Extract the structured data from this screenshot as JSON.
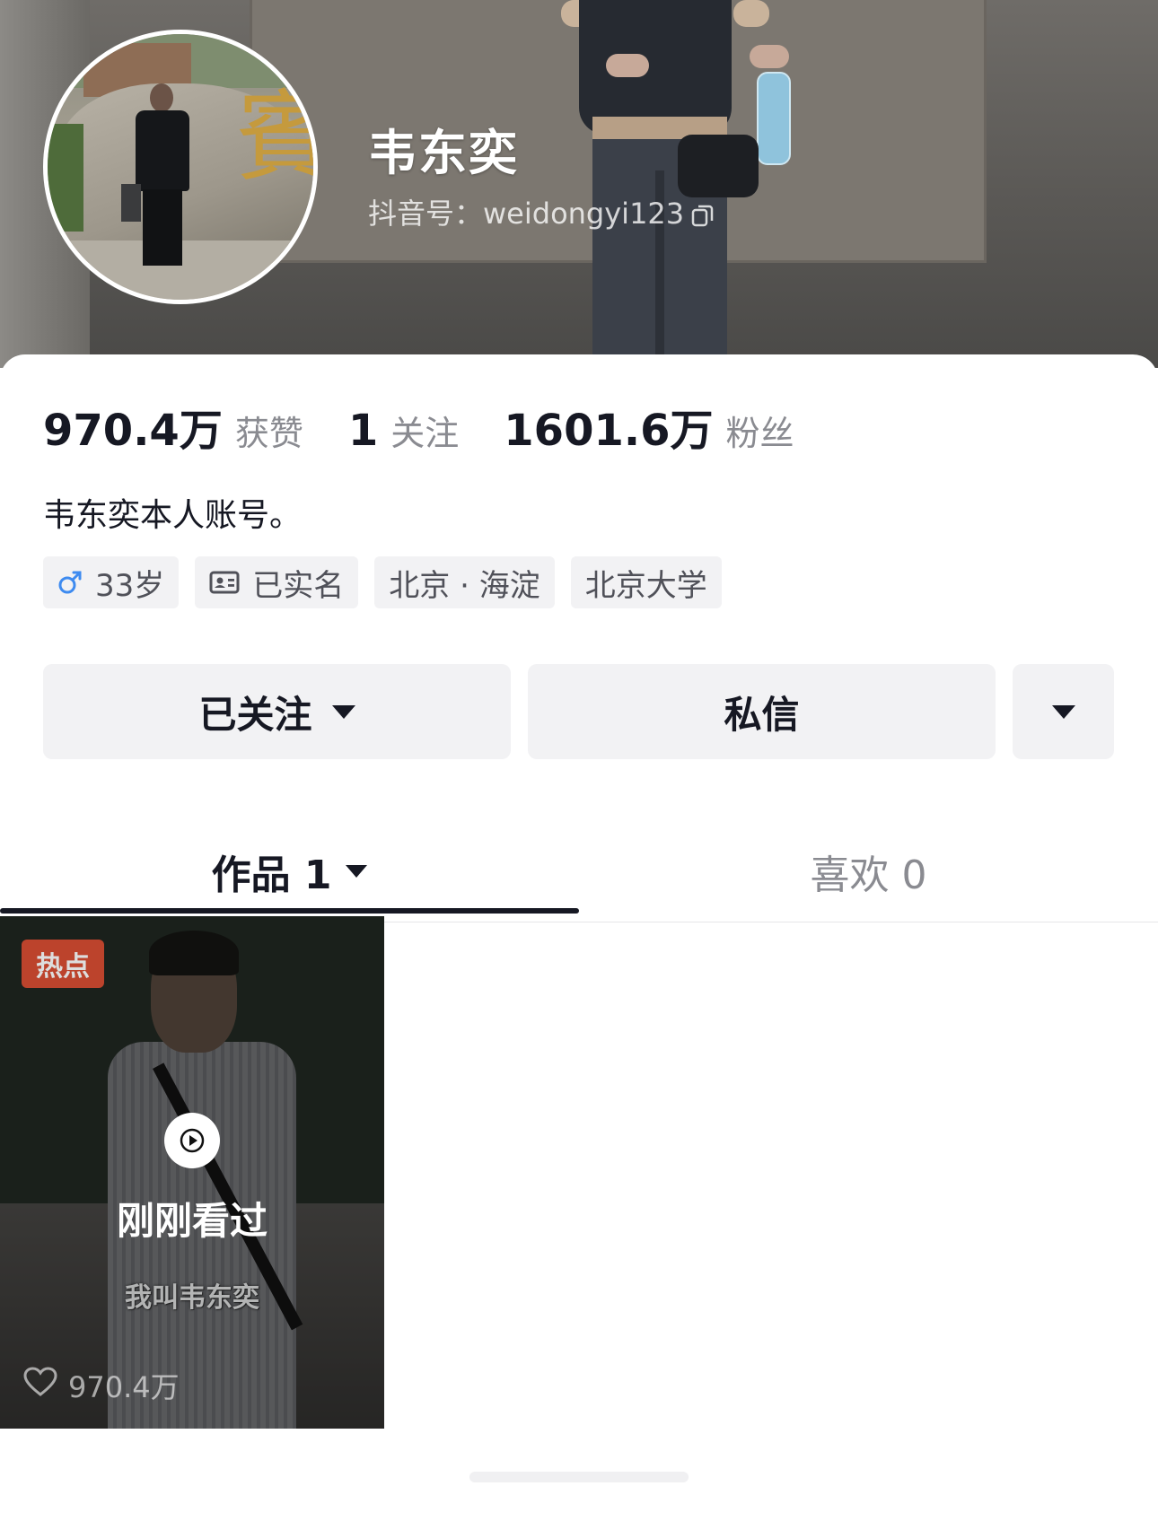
{
  "profile": {
    "name": "韦东奕",
    "douyin_id": "抖音号：weidongyi123",
    "bio": "韦东奕本人账号。"
  },
  "stats": {
    "likes_num": "970.4万",
    "likes_label": "获赞",
    "following_num": "1",
    "following_label": "关注",
    "followers_num": "1601.6万",
    "followers_label": "粉丝"
  },
  "tags": {
    "age": "33岁",
    "verified": "已实名",
    "location": "北京 · 海淀",
    "school": "北京大学"
  },
  "actions": {
    "follow_label": "已关注",
    "message_label": "私信"
  },
  "tabs": {
    "works": "作品 1",
    "likes": "喜欢 0"
  },
  "video": {
    "badge": "热点",
    "watched_label": "刚刚看过",
    "subtitle": "我叫韦东奕",
    "like_count": "970.4万"
  },
  "colors": {
    "text_primary": "#161823",
    "text_secondary": "#8a8b91",
    "tag_bg": "#f2f2f4",
    "male_icon": "#3e8bf0",
    "hot_badge": "#d94a2f"
  },
  "icons": {
    "copy": "copy-icon",
    "gender": "male-icon",
    "verified": "id-card-icon",
    "dropdown": "caret-down-icon",
    "play": "play-icon",
    "like": "heart-icon"
  }
}
